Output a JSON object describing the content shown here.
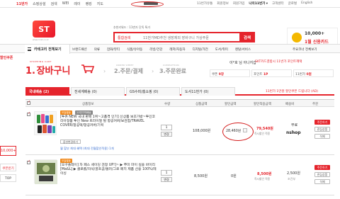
{
  "topbar": {
    "nav": [
      "11번가",
      "쇼핑상설",
      "검색",
      "WEI",
      "레이",
      "랭킹",
      "지도"
    ],
    "links": [
      "11번가유통",
      "회원정보",
      "회원가입",
      "나의11번가 ▾",
      "고객센터",
      "글로벌",
      "English"
    ],
    "circled_label": "장바구니(0)"
  },
  "header": {
    "logo": "ST",
    "logo_sub": "www.11st.co.kr",
    "search_select": "통합검색",
    "search_placeholder": "11번가MD추천 냉장제외 장바구니 가상주문",
    "search_button": "검색",
    "hot_keywords": "추천키워드 : 11번가 단독 특가",
    "banner_amount": "10,000+",
    "banner_text": "1월 신용카드"
  },
  "catbar": {
    "all": "카테고리 전체보기",
    "items": [
      "브랜드패션",
      "의류",
      "잡화/뷰티",
      "식품/유아동",
      "리빙/건강",
      "레저/자동차",
      "디지털/가전",
      "도서/취미",
      "렌탈/서비스"
    ],
    "right": "주요코너 전체보기"
  },
  "leftrail": {
    "head": "할인쿠폰",
    "box1": "10,000+",
    "box2": "쿠폰받기",
    "box3": "TOP"
  },
  "steps": {
    "s1_sub": "SHOPPING CART",
    "s1_num": "1.",
    "s1_label": "장바구니",
    "s2_sub": "ORDER SHEET",
    "s2": "2.주문/결제",
    "s3_sub": "COMPLETION",
    "s3": "3.주문완료",
    "arrow": "›"
  },
  "mybox": {
    "greeting": "이*호 님 아나지갑",
    "promo": "SKT카드결합시 11번가 포인트혜택",
    "cols": [
      {
        "label": "쿠폰",
        "value": "9장"
      },
      {
        "label": "포인트",
        "value": "1P"
      },
      {
        "label": "11번가",
        "value": "0원"
      }
    ]
  },
  "tabs": {
    "items": [
      "국내배송 (2)",
      "전세계배송 (0)",
      "GS수퍼/홈쇼핑 (0)",
      "도서11번가 (0)"
    ],
    "note": "11번가 1만원 할인쿠폰 드립니다 (AD)"
  },
  "thead": [
    "상품정보",
    "수량",
    "상품금액",
    "할인금액",
    "할인적용금액",
    "배송비",
    "주문"
  ],
  "rows": [
    {
      "badge": "오늘발송",
      "badge2": "11번가직배송",
      "name": "[투큐 NEW 국내 판매 1위~고품격 인기] 신상품 보조가방~투인코리아정품 투인 New 트라이얼 탈 항공커버/보관함/TRAVEL COVER/항공택/항공커버/기획",
      "option_btn": "옵션변경하기",
      "sub": "월 할부 최대 혜택 (최대 전월할인적용) 1개",
      "qty": "1",
      "qty_btn": "변경",
      "price": "108,000원",
      "discount": "28,460원",
      "final": "79,540원",
      "final_sub": "즉시할인 적용",
      "ship": "무료",
      "seller": "nshop",
      "btn1": "주문하기",
      "btn2": "관심상품",
      "btn3": "삭제"
    },
    {
      "badge": "오늘발송",
      "name": "[오구플레이] 차 페스 세이딩 검정 UP!]~ ▶ 쭈미 마이 실용 바이리 [Ma&L] ▶ 클로롤/자석/골프공/볼러/그로 페치 제품 산용 100%/레이싱",
      "qty": "1",
      "qty_btn": "변경",
      "price": "8,500원",
      "discount": "0원",
      "final": "8,500원",
      "final_sub": "즉시할인 적용",
      "ship": "2,500원",
      "ship_note": "조건부",
      "btn1": "주문하기",
      "btn2": "관심상품",
      "btn3": "삭제"
    }
  ],
  "colors": {
    "accent": "#e5242c"
  }
}
